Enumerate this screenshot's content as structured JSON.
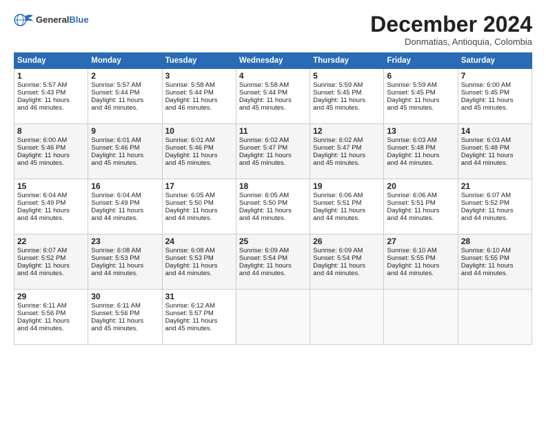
{
  "header": {
    "logo_general": "General",
    "logo_blue": "Blue",
    "month_title": "December 2024",
    "subtitle": "Donmatias, Antioquia, Colombia"
  },
  "days_header": [
    "Sunday",
    "Monday",
    "Tuesday",
    "Wednesday",
    "Thursday",
    "Friday",
    "Saturday"
  ],
  "weeks": [
    [
      {
        "day": "1",
        "lines": [
          "Sunrise: 5:57 AM",
          "Sunset: 5:43 PM",
          "Daylight: 11 hours",
          "and 46 minutes."
        ]
      },
      {
        "day": "2",
        "lines": [
          "Sunrise: 5:57 AM",
          "Sunset: 5:44 PM",
          "Daylight: 11 hours",
          "and 46 minutes."
        ]
      },
      {
        "day": "3",
        "lines": [
          "Sunrise: 5:58 AM",
          "Sunset: 5:44 PM",
          "Daylight: 11 hours",
          "and 46 minutes."
        ]
      },
      {
        "day": "4",
        "lines": [
          "Sunrise: 5:58 AM",
          "Sunset: 5:44 PM",
          "Daylight: 11 hours",
          "and 45 minutes."
        ]
      },
      {
        "day": "5",
        "lines": [
          "Sunrise: 5:59 AM",
          "Sunset: 5:45 PM",
          "Daylight: 11 hours",
          "and 45 minutes."
        ]
      },
      {
        "day": "6",
        "lines": [
          "Sunrise: 5:59 AM",
          "Sunset: 5:45 PM",
          "Daylight: 11 hours",
          "and 45 minutes."
        ]
      },
      {
        "day": "7",
        "lines": [
          "Sunrise: 6:00 AM",
          "Sunset: 5:45 PM",
          "Daylight: 11 hours",
          "and 45 minutes."
        ]
      }
    ],
    [
      {
        "day": "8",
        "lines": [
          "Sunrise: 6:00 AM",
          "Sunset: 5:46 PM",
          "Daylight: 11 hours",
          "and 45 minutes."
        ]
      },
      {
        "day": "9",
        "lines": [
          "Sunrise: 6:01 AM",
          "Sunset: 5:46 PM",
          "Daylight: 11 hours",
          "and 45 minutes."
        ]
      },
      {
        "day": "10",
        "lines": [
          "Sunrise: 6:01 AM",
          "Sunset: 5:46 PM",
          "Daylight: 11 hours",
          "and 45 minutes."
        ]
      },
      {
        "day": "11",
        "lines": [
          "Sunrise: 6:02 AM",
          "Sunset: 5:47 PM",
          "Daylight: 11 hours",
          "and 45 minutes."
        ]
      },
      {
        "day": "12",
        "lines": [
          "Sunrise: 6:02 AM",
          "Sunset: 5:47 PM",
          "Daylight: 11 hours",
          "and 45 minutes."
        ]
      },
      {
        "day": "13",
        "lines": [
          "Sunrise: 6:03 AM",
          "Sunset: 5:48 PM",
          "Daylight: 11 hours",
          "and 44 minutes."
        ]
      },
      {
        "day": "14",
        "lines": [
          "Sunrise: 6:03 AM",
          "Sunset: 5:48 PM",
          "Daylight: 11 hours",
          "and 44 minutes."
        ]
      }
    ],
    [
      {
        "day": "15",
        "lines": [
          "Sunrise: 6:04 AM",
          "Sunset: 5:49 PM",
          "Daylight: 11 hours",
          "and 44 minutes."
        ]
      },
      {
        "day": "16",
        "lines": [
          "Sunrise: 6:04 AM",
          "Sunset: 5:49 PM",
          "Daylight: 11 hours",
          "and 44 minutes."
        ]
      },
      {
        "day": "17",
        "lines": [
          "Sunrise: 6:05 AM",
          "Sunset: 5:50 PM",
          "Daylight: 11 hours",
          "and 44 minutes."
        ]
      },
      {
        "day": "18",
        "lines": [
          "Sunrise: 6:05 AM",
          "Sunset: 5:50 PM",
          "Daylight: 11 hours",
          "and 44 minutes."
        ]
      },
      {
        "day": "19",
        "lines": [
          "Sunrise: 6:06 AM",
          "Sunset: 5:51 PM",
          "Daylight: 11 hours",
          "and 44 minutes."
        ]
      },
      {
        "day": "20",
        "lines": [
          "Sunrise: 6:06 AM",
          "Sunset: 5:51 PM",
          "Daylight: 11 hours",
          "and 44 minutes."
        ]
      },
      {
        "day": "21",
        "lines": [
          "Sunrise: 6:07 AM",
          "Sunset: 5:52 PM",
          "Daylight: 11 hours",
          "and 44 minutes."
        ]
      }
    ],
    [
      {
        "day": "22",
        "lines": [
          "Sunrise: 6:07 AM",
          "Sunset: 5:52 PM",
          "Daylight: 11 hours",
          "and 44 minutes."
        ]
      },
      {
        "day": "23",
        "lines": [
          "Sunrise: 6:08 AM",
          "Sunset: 5:53 PM",
          "Daylight: 11 hours",
          "and 44 minutes."
        ]
      },
      {
        "day": "24",
        "lines": [
          "Sunrise: 6:08 AM",
          "Sunset: 5:53 PM",
          "Daylight: 11 hours",
          "and 44 minutes."
        ]
      },
      {
        "day": "25",
        "lines": [
          "Sunrise: 6:09 AM",
          "Sunset: 5:54 PM",
          "Daylight: 11 hours",
          "and 44 minutes."
        ]
      },
      {
        "day": "26",
        "lines": [
          "Sunrise: 6:09 AM",
          "Sunset: 5:54 PM",
          "Daylight: 11 hours",
          "and 44 minutes."
        ]
      },
      {
        "day": "27",
        "lines": [
          "Sunrise: 6:10 AM",
          "Sunset: 5:55 PM",
          "Daylight: 11 hours",
          "and 44 minutes."
        ]
      },
      {
        "day": "28",
        "lines": [
          "Sunrise: 6:10 AM",
          "Sunset: 5:55 PM",
          "Daylight: 11 hours",
          "and 44 minutes."
        ]
      }
    ],
    [
      {
        "day": "29",
        "lines": [
          "Sunrise: 6:11 AM",
          "Sunset: 5:56 PM",
          "Daylight: 11 hours",
          "and 44 minutes."
        ]
      },
      {
        "day": "30",
        "lines": [
          "Sunrise: 6:11 AM",
          "Sunset: 5:56 PM",
          "Daylight: 11 hours",
          "and 45 minutes."
        ]
      },
      {
        "day": "31",
        "lines": [
          "Sunrise: 6:12 AM",
          "Sunset: 5:57 PM",
          "Daylight: 11 hours",
          "and 45 minutes."
        ]
      },
      {
        "day": "",
        "lines": []
      },
      {
        "day": "",
        "lines": []
      },
      {
        "day": "",
        "lines": []
      },
      {
        "day": "",
        "lines": []
      }
    ]
  ]
}
